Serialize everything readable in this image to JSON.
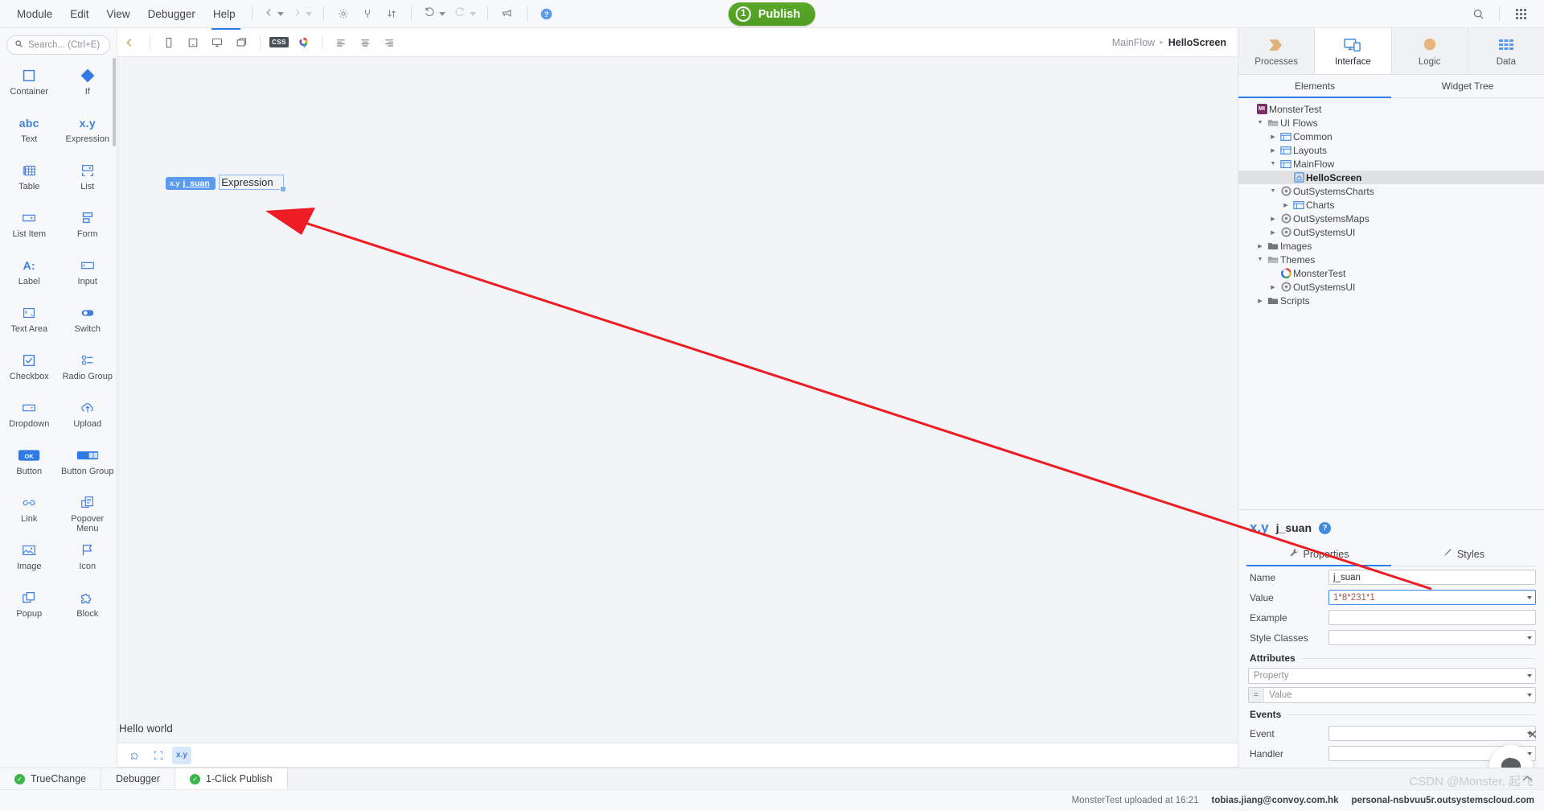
{
  "menubar": {
    "items": [
      "Module",
      "Edit",
      "View",
      "Debugger",
      "Help"
    ],
    "nav_back_icon": "chevron-left-icon",
    "nav_forward_icon": "chevron-right-icon",
    "tool_icons": [
      "gear-icon",
      "plug-icon",
      "sort-icon",
      "undo-icon",
      "redo-icon",
      "megaphone-icon",
      "help-icon"
    ],
    "right_icons": [
      "search-icon",
      "apps-grid-icon"
    ],
    "publish": {
      "label": "Publish",
      "count": "1",
      "color": "#4e9d22"
    }
  },
  "palette": {
    "search_placeholder": "Search... (Ctrl+E)",
    "search_value": "",
    "items": [
      {
        "label": "Container",
        "icon": "container-icon"
      },
      {
        "label": "If",
        "icon": "if-diamond-icon"
      },
      {
        "label": "Text",
        "icon": "abc-text-icon",
        "glyph": "abc"
      },
      {
        "label": "Expression",
        "icon": "xy-expression-icon",
        "glyph": "x.y"
      },
      {
        "label": "Table",
        "icon": "table-icon"
      },
      {
        "label": "List",
        "icon": "list-icon"
      },
      {
        "label": "List Item",
        "icon": "list-item-icon"
      },
      {
        "label": "Form",
        "icon": "form-icon"
      },
      {
        "label": "Label",
        "icon": "label-icon",
        "glyph": "A:"
      },
      {
        "label": "Input",
        "icon": "input-icon"
      },
      {
        "label": "Text Area",
        "icon": "text-area-icon"
      },
      {
        "label": "Switch",
        "icon": "switch-icon"
      },
      {
        "label": "Checkbox",
        "icon": "checkbox-icon"
      },
      {
        "label": "Radio Group",
        "icon": "radio-group-icon"
      },
      {
        "label": "Dropdown",
        "icon": "dropdown-icon"
      },
      {
        "label": "Upload",
        "icon": "upload-cloud-icon"
      },
      {
        "label": "Button",
        "icon": "button-ok-icon",
        "glyph": "OK"
      },
      {
        "label": "Button Group",
        "icon": "button-group-icon"
      },
      {
        "label": "Link",
        "icon": "link-chain-icon"
      },
      {
        "label": "Popover Menu",
        "icon": "popover-menu-icon"
      },
      {
        "label": "Image",
        "icon": "image-icon"
      },
      {
        "label": "Icon",
        "icon": "flag-icon"
      },
      {
        "label": "Popup",
        "icon": "popup-icon"
      },
      {
        "label": "Block",
        "icon": "puzzle-block-icon"
      }
    ]
  },
  "canvas_toolbar": {
    "collapse_icon": "chevron-left-icon",
    "device_icons": [
      "phone-icon",
      "tablet-icon",
      "desktop-icon",
      "native-icon"
    ],
    "style_icons": [
      "css-chip-icon",
      "palette-icon"
    ],
    "align_icons": [
      "align-left-icon",
      "align-center-icon",
      "align-right-icon"
    ],
    "css_label": "CSS",
    "breadcrumb": {
      "parent": "MainFlow",
      "separator": "▸",
      "current": "HelloScreen"
    }
  },
  "canvas": {
    "widget": {
      "type_glyph": "x.y",
      "name": "j_suan",
      "text": "Expression"
    },
    "page_text": "Hello world",
    "footer_icons": [
      "block-icon",
      "container-icon",
      "expression-icon"
    ],
    "footer_active_glyph": "x.y"
  },
  "rightpanel": {
    "tabs": [
      {
        "label": "Processes",
        "icon": "process-chevron-icon",
        "active": false
      },
      {
        "label": "Interface",
        "icon": "interface-screen-icon",
        "active": true
      },
      {
        "label": "Logic",
        "icon": "logic-circle-icon",
        "active": false
      },
      {
        "label": "Data",
        "icon": "data-grid-icon",
        "active": false
      }
    ],
    "subtabs": [
      {
        "label": "Elements",
        "active": true
      },
      {
        "label": "Widget Tree",
        "active": false
      }
    ],
    "tree": [
      {
        "label": "MonsterTest",
        "indent": 0,
        "twisty": "",
        "icon": "module-badge-icon",
        "selected": false
      },
      {
        "label": "UI Flows",
        "indent": 1,
        "twisty": "down",
        "icon": "folder-open-icon",
        "selected": false
      },
      {
        "label": "Common",
        "indent": 2,
        "twisty": "right",
        "icon": "flow-icon",
        "selected": false
      },
      {
        "label": "Layouts",
        "indent": 2,
        "twisty": "right",
        "icon": "flow-icon",
        "selected": false
      },
      {
        "label": "MainFlow",
        "indent": 2,
        "twisty": "down",
        "icon": "flow-icon",
        "selected": false
      },
      {
        "label": "HelloScreen",
        "indent": 3,
        "twisty": "",
        "icon": "screen-icon",
        "selected": true
      },
      {
        "label": "OutSystemsCharts",
        "indent": 2,
        "twisty": "down",
        "icon": "module-ref-icon",
        "selected": false
      },
      {
        "label": "Charts",
        "indent": 3,
        "twisty": "right",
        "icon": "flow-icon",
        "selected": false
      },
      {
        "label": "OutSystemsMaps",
        "indent": 2,
        "twisty": "right",
        "icon": "module-ref-icon",
        "selected": false
      },
      {
        "label": "OutSystemsUI",
        "indent": 2,
        "twisty": "right",
        "icon": "module-ref-icon",
        "selected": false
      },
      {
        "label": "Images",
        "indent": 1,
        "twisty": "right",
        "icon": "folder-icon",
        "selected": false
      },
      {
        "label": "Themes",
        "indent": 1,
        "twisty": "down",
        "icon": "folder-open-icon",
        "selected": false
      },
      {
        "label": "MonsterTest",
        "indent": 2,
        "twisty": "",
        "icon": "theme-icon",
        "selected": false
      },
      {
        "label": "OutSystemsUI",
        "indent": 2,
        "twisty": "right",
        "icon": "module-ref-icon",
        "selected": false
      },
      {
        "label": "Scripts",
        "indent": 1,
        "twisty": "right",
        "icon": "folder-icon",
        "selected": false
      }
    ],
    "properties": {
      "header_glyph": "x.y",
      "header_name": "j_suan",
      "help_glyph": "?",
      "tabs": [
        {
          "label": "Properties",
          "icon": "wrench-icon",
          "active": true
        },
        {
          "label": "Styles",
          "icon": "brush-icon",
          "active": false
        }
      ],
      "rows": [
        {
          "label": "Name",
          "value": "j_suan",
          "placeholder": "",
          "dropdown": false,
          "focused": false,
          "expr": false
        },
        {
          "label": "Value",
          "value": "1*8*231*1",
          "placeholder": "",
          "dropdown": true,
          "focused": true,
          "expr": true
        },
        {
          "label": "Example",
          "value": "",
          "placeholder": "",
          "dropdown": false,
          "focused": false,
          "expr": false
        },
        {
          "label": "Style Classes",
          "value": "",
          "placeholder": "",
          "dropdown": true,
          "focused": false,
          "expr": false
        }
      ],
      "attributes": {
        "title": "Attributes",
        "property_placeholder": "Property",
        "value_placeholder": "Value",
        "eq_glyph": "="
      },
      "events": {
        "title": "Events",
        "rows": [
          {
            "label": "Event",
            "value": ""
          },
          {
            "label": "Handler",
            "value": ""
          }
        ]
      }
    },
    "chat": {
      "icon": "chat-bubble-icon",
      "close_icon": "close-icon"
    }
  },
  "bottom_tabs": [
    {
      "label": "TrueChange",
      "status": "ok",
      "active": false
    },
    {
      "label": "Debugger",
      "status": "none",
      "active": false
    },
    {
      "label": "1-Click Publish",
      "status": "ok",
      "active": true
    }
  ],
  "statusbar": {
    "upload_text": "MonsterTest uploaded at 16:21",
    "user_email": "tobias.jiang@convoy.com.hk",
    "environment": "personal-nsbvuu5r.outsystemscloud.com",
    "watermark": "CSDN @Monster, 起飞"
  }
}
